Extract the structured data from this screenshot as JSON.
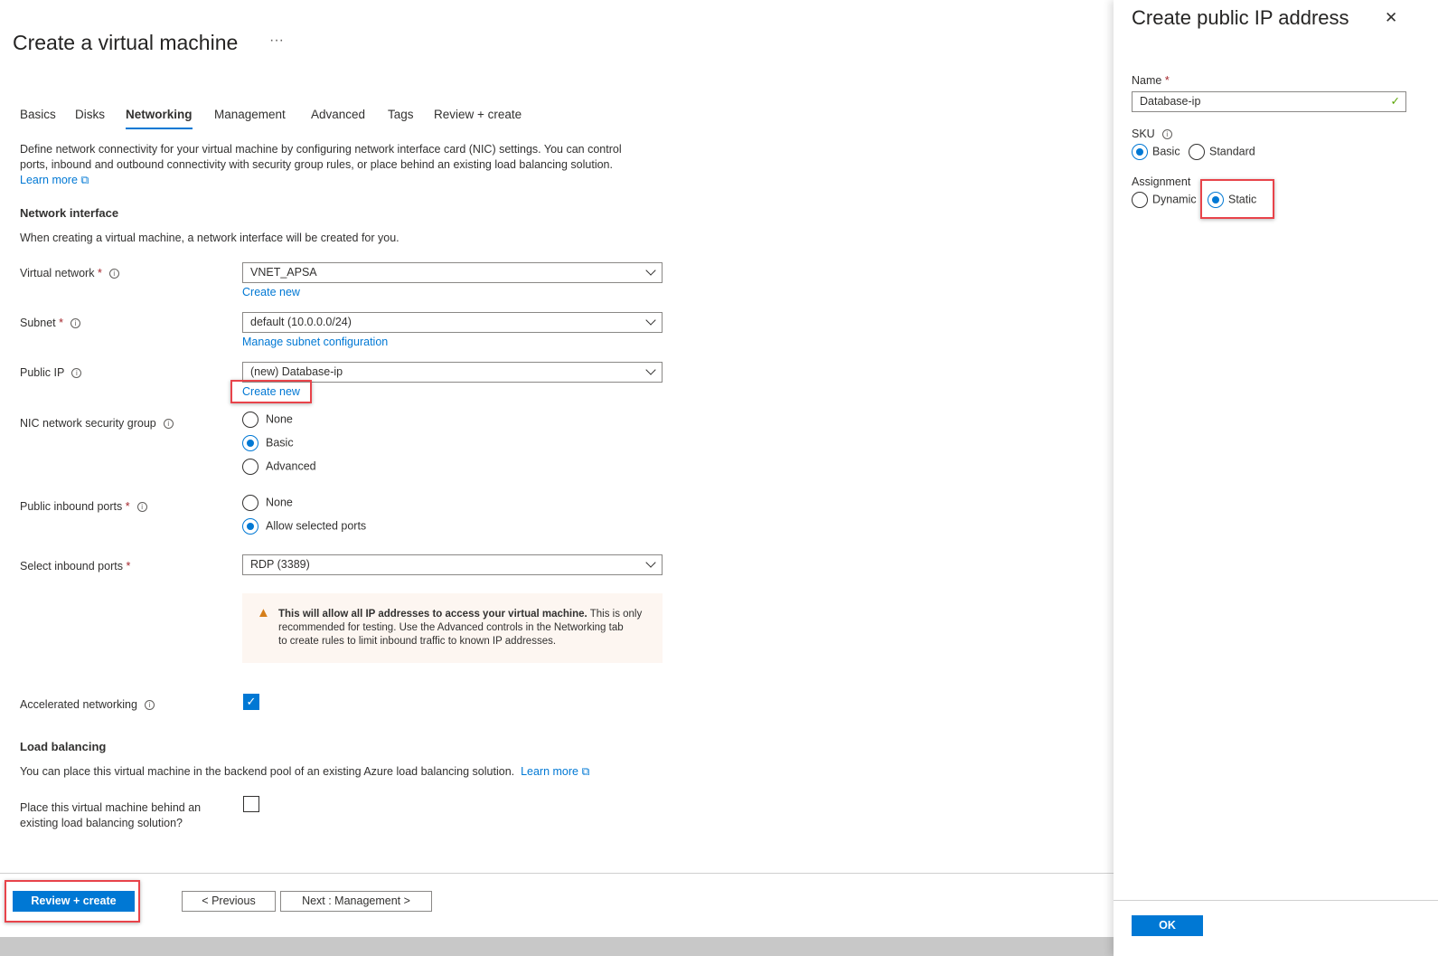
{
  "page": {
    "title": "Create a virtual machine",
    "more": "···"
  },
  "tabs": [
    "Basics",
    "Disks",
    "Networking",
    "Management",
    "Advanced",
    "Tags",
    "Review + create"
  ],
  "intro": {
    "text1": "Define network connectivity for your virtual machine by configuring network interface card (NIC) settings. You can control",
    "text2": "ports, inbound and outbound connectivity with security group rules, or place behind an existing load balancing solution.",
    "learn_more": "Learn more"
  },
  "network_interface": {
    "heading": "Network interface",
    "desc": "When creating a virtual machine, a network interface will be created for you.",
    "vnet_label": "Virtual network",
    "vnet_value": "VNET_APSA",
    "vnet_link": "Create new",
    "subnet_label": "Subnet",
    "subnet_value": "default (10.0.0.0/24)",
    "subnet_link": "Manage subnet configuration",
    "pip_label": "Public IP",
    "pip_value": "(new) Database-ip",
    "pip_link": "Create new",
    "nsg_label": "NIC network security group",
    "nsg_options": [
      "None",
      "Basic",
      "Advanced"
    ],
    "nsg_selected": "Basic",
    "inbound_label": "Public inbound ports",
    "inbound_options": [
      "None",
      "Allow selected ports"
    ],
    "inbound_selected": "Allow selected ports",
    "select_ports_label": "Select inbound ports",
    "select_ports_value": "RDP (3389)",
    "warning_bold": "This will allow all IP addresses to access your virtual machine.",
    "warning_rest1": " This is only",
    "warning_rest2": "recommended for testing.  Use the Advanced controls in the Networking tab",
    "warning_rest3": "to create rules to limit inbound traffic to known IP addresses.",
    "accel_label": "Accelerated networking",
    "accel_checked": true
  },
  "load_balancing": {
    "heading": "Load balancing",
    "desc": "You can place this virtual machine in the backend pool of an existing Azure load balancing solution.",
    "learn_more": "Learn more",
    "place_label1": "Place this virtual machine behind an",
    "place_label2": "existing load balancing solution?",
    "place_checked": false
  },
  "footer": {
    "review": "Review + create",
    "previous": "< Previous",
    "next": "Next : Management >"
  },
  "panel": {
    "title": "Create public IP address",
    "close": "✕",
    "name_label": "Name",
    "name_value": "Database-ip",
    "sku_label": "SKU",
    "sku_options": [
      "Basic",
      "Standard"
    ],
    "sku_selected": "Basic",
    "assign_label": "Assignment",
    "assign_options": [
      "Dynamic",
      "Static"
    ],
    "assign_selected": "Static",
    "ok": "OK"
  },
  "req_mark": "*",
  "info": "i"
}
